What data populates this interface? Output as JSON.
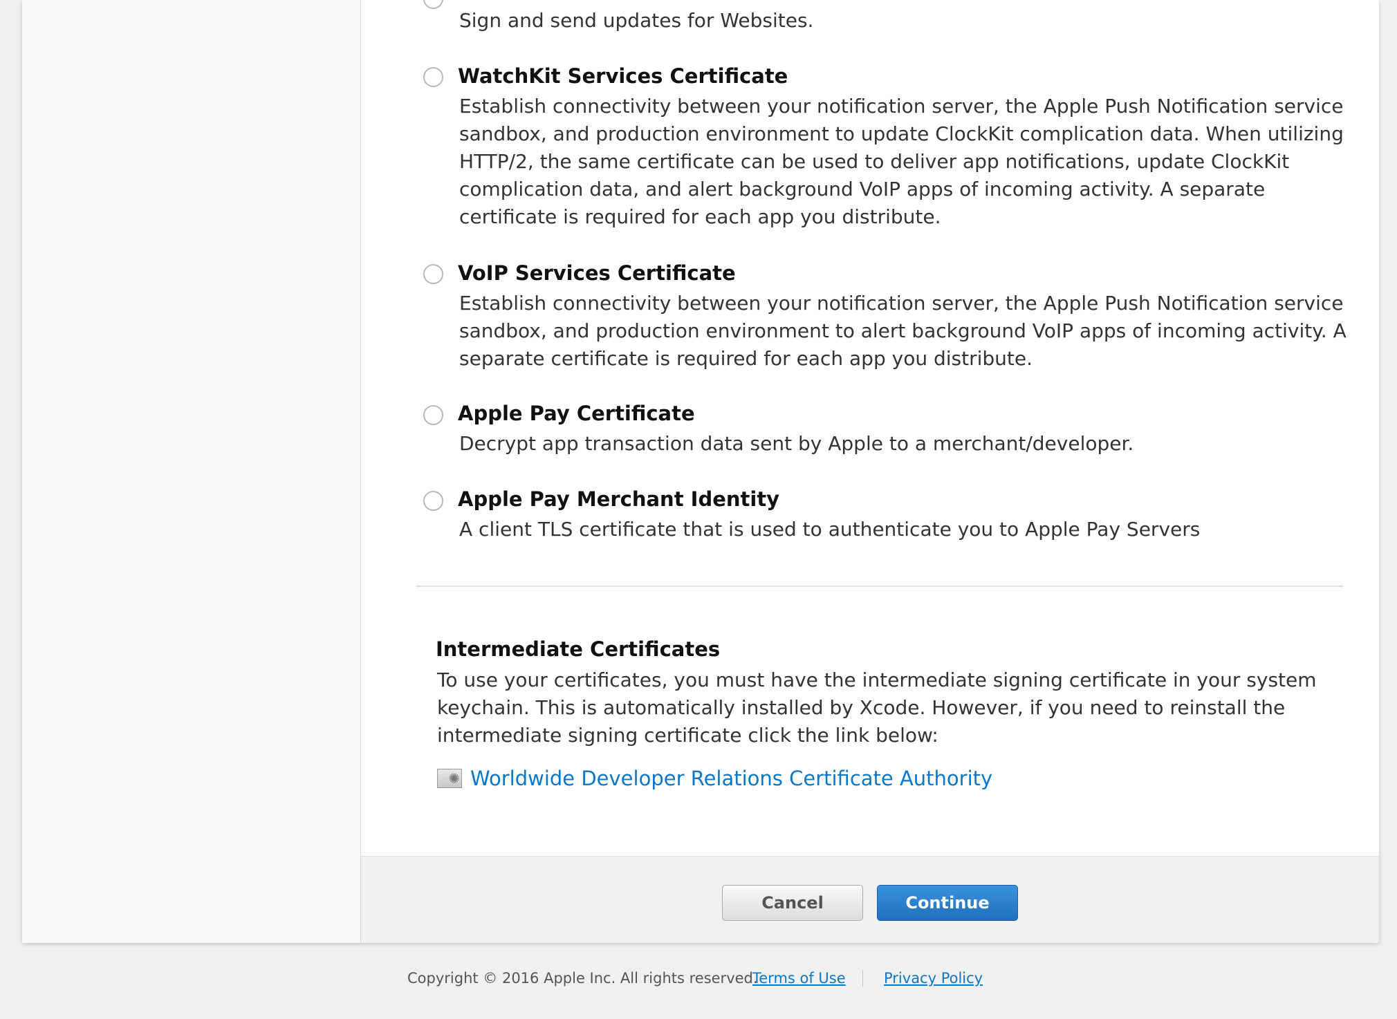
{
  "options": [
    {
      "title": "",
      "description": "Sign and send updates for Websites."
    },
    {
      "title": "WatchKit Services Certificate",
      "description": "Establish connectivity between your notification server, the Apple Push Notification service sandbox, and production environment to update ClockKit complication data. When utilizing HTTP/2, the same certificate can be used to deliver app notifications, update ClockKit complication data, and alert background VoIP apps of incoming activity. A separate certificate is required for each app you distribute."
    },
    {
      "title": "VoIP Services Certificate",
      "description": "Establish connectivity between your notification server, the Apple Push Notification service sandbox, and production environment to alert background VoIP apps of incoming activity. A separate certificate is required for each app you distribute."
    },
    {
      "title": "Apple Pay Certificate",
      "description": "Decrypt app transaction data sent by Apple to a merchant/developer."
    },
    {
      "title": "Apple Pay Merchant Identity",
      "description": "A client TLS certificate that is used to authenticate you to Apple Pay Servers"
    }
  ],
  "intermediate": {
    "title": "Intermediate Certificates",
    "description": "To use your certificates, you must have the intermediate signing certificate in your system keychain. This is automatically installed by Xcode. However, if you need to reinstall the intermediate signing certificate click the link below:",
    "link_text": "Worldwide Developer Relations Certificate Authority"
  },
  "buttons": {
    "cancel": "Cancel",
    "continue": "Continue"
  },
  "footer": {
    "copyright": "Copyright © 2016 Apple Inc. All rights reserved.",
    "terms": "Terms of Use",
    "privacy": "Privacy Policy"
  },
  "colors": {
    "link": "#0a78c8",
    "primary_button": "#2a7fcc"
  }
}
